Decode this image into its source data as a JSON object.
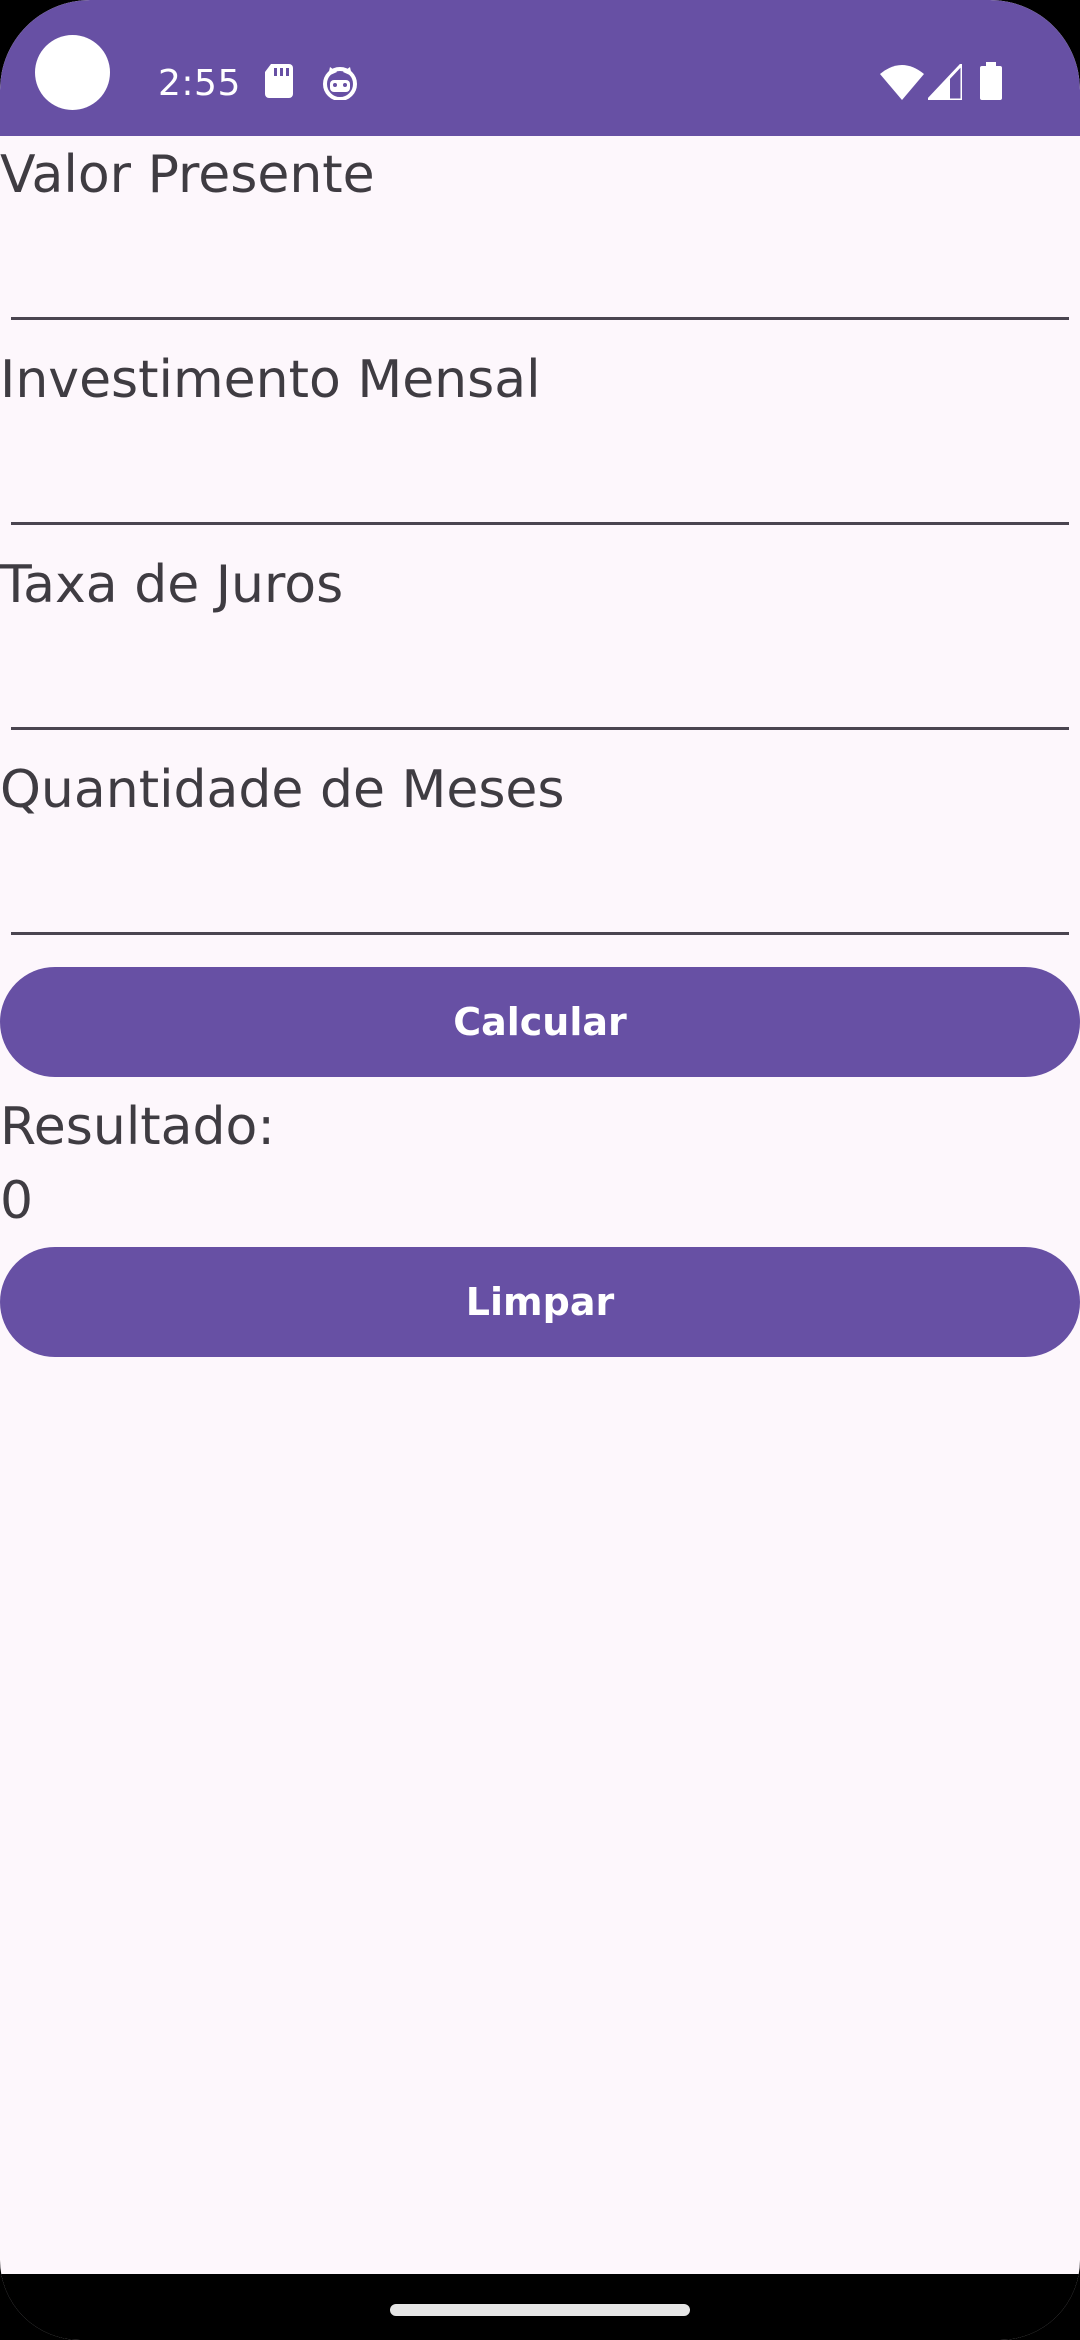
{
  "status_bar": {
    "time": "2:55",
    "icons": [
      "sd-card-icon",
      "cat-face-icon",
      "wifi-icon",
      "cell-signal-icon",
      "battery-icon"
    ],
    "background": "#6750a4"
  },
  "form": {
    "valor_presente": {
      "label": "Valor Presente",
      "value": ""
    },
    "investimento_mensal": {
      "label": "Investimento Mensal",
      "value": ""
    },
    "taxa_juros": {
      "label": "Taxa de Juros",
      "value": ""
    },
    "quantidade_meses": {
      "label": "Quantidade de Meses",
      "value": ""
    }
  },
  "buttons": {
    "calcular": "Calcular",
    "limpar": "Limpar"
  },
  "result": {
    "label": "Resultado:",
    "value": "0"
  },
  "colors": {
    "accent": "#6750a4",
    "background": "#fdf7fc",
    "text": "#3f3c42"
  }
}
